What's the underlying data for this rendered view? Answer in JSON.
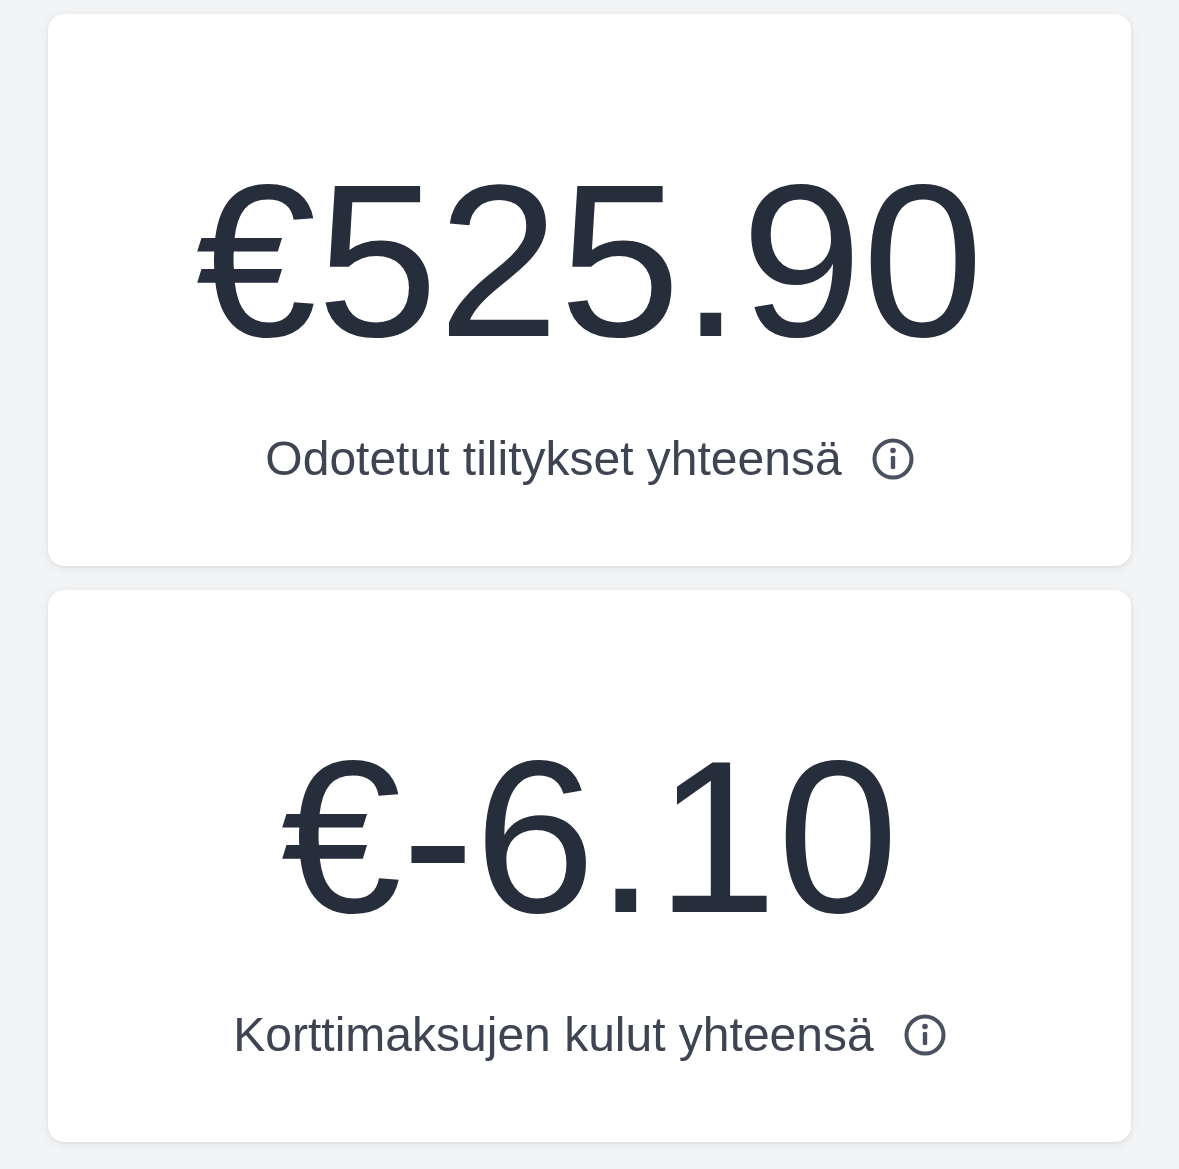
{
  "cards": [
    {
      "amount": "€525.90",
      "label": "Odotetut tilitykset yhteensä"
    },
    {
      "amount": "€-6.10",
      "label": "Korttimaksujen kulut yhteensä"
    }
  ]
}
